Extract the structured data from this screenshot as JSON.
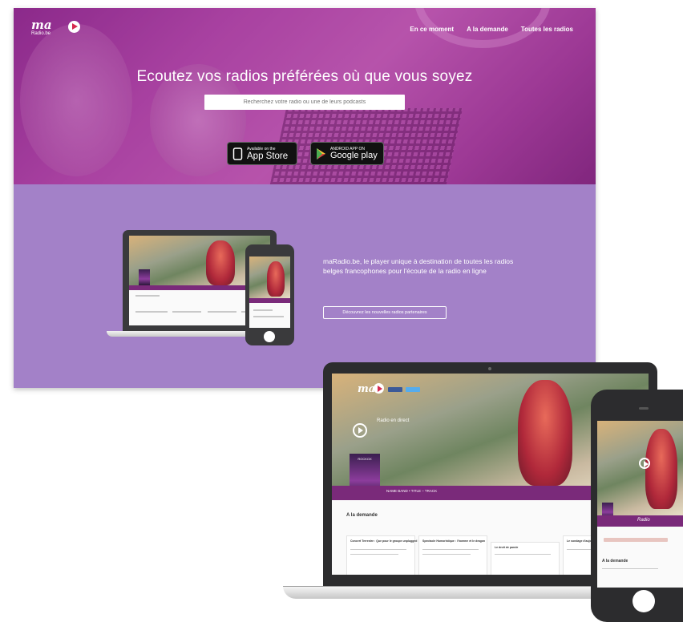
{
  "site": {
    "logo": {
      "text": "ma",
      "subtitle": "Radio.be"
    },
    "nav": [
      "En ce moment",
      "A la demande",
      "Toutes les radios"
    ],
    "headline": "Ecoutez vos radios préférées où que vous soyez",
    "search": {
      "placeholder": "Recherchez votre radio ou une de leurs podcasts"
    },
    "app_store": {
      "small": "Available on the",
      "big": "App Store"
    },
    "google_play": {
      "small": "ANDROID APP ON",
      "big": "Google play"
    },
    "blurb": "maRadio.be, le player unique à destination de toutes les radios belges francophones pour l'écoute de la radio en ligne",
    "cta": "Découvrez les nouvelles radios partenaires"
  },
  "mockup": {
    "laptop": {
      "logo": "ma",
      "section": "A la demande",
      "now_playing": "Radio en direct",
      "track": "NAME BAND • TITLE – TRACK",
      "album": "ROCKOX",
      "cards": [
        "Concert Terrestre : Que pour le groupe unplugged",
        "Spectacle Humoristique : l'homme et le dragon",
        "Le droit de parole",
        "Le sondage d'aujourd'hui"
      ]
    },
    "phone": {
      "section": "A la demande",
      "label": "Radio"
    }
  }
}
